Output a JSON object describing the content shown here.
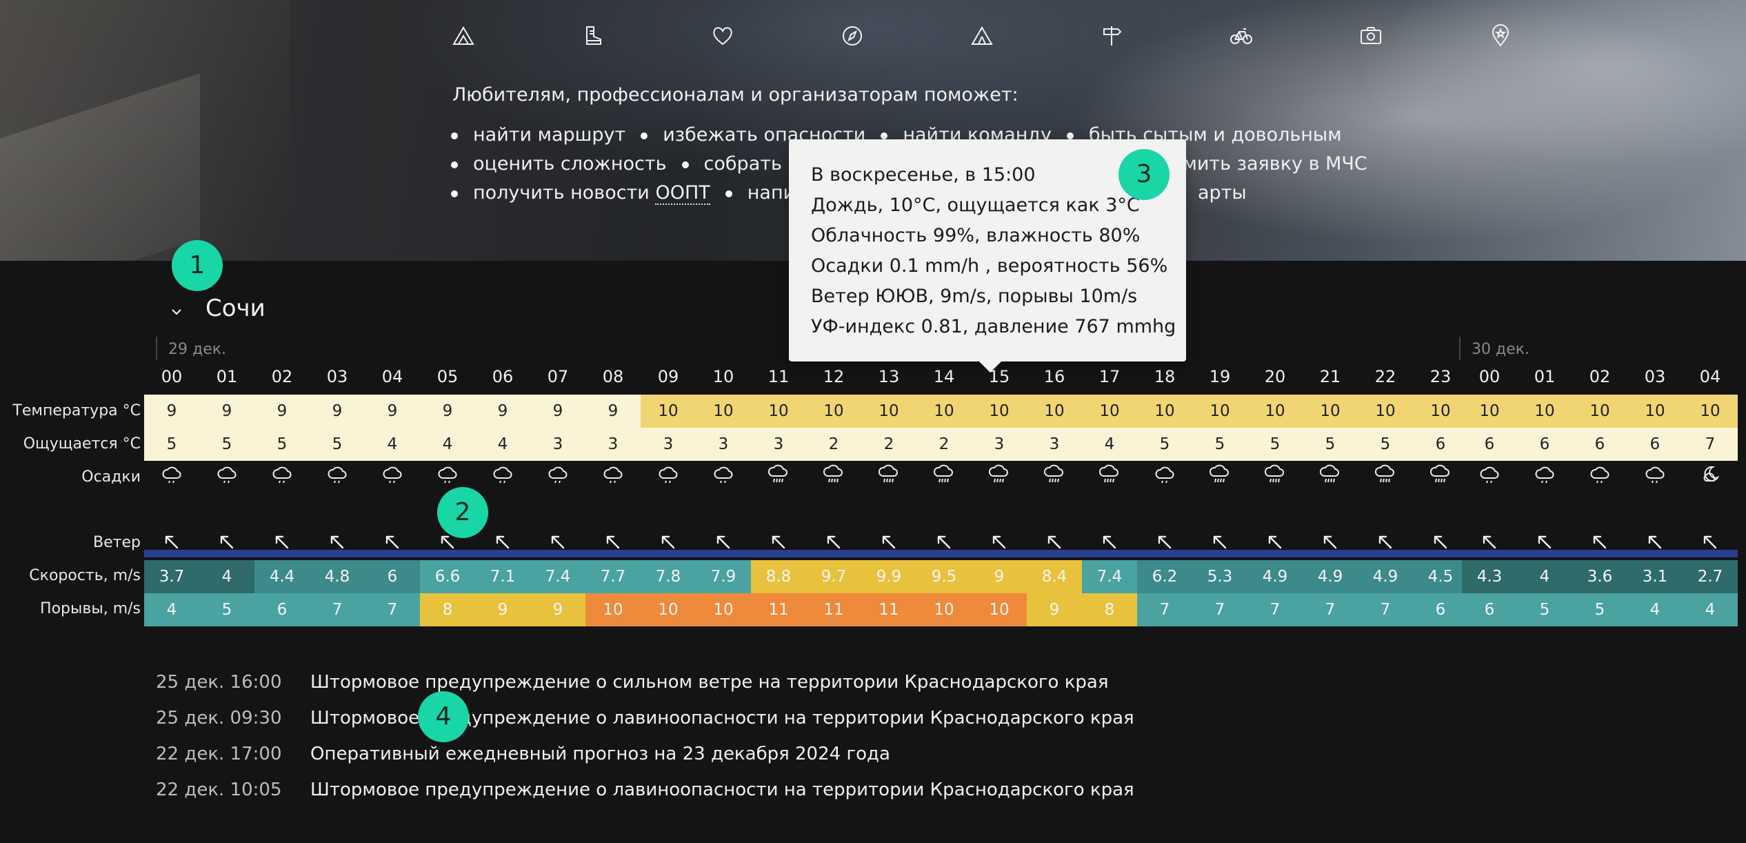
{
  "hero": {
    "icons": [
      "mountain-icon",
      "boot-icon",
      "heart-icon",
      "compass-icon",
      "tent-icon",
      "signpost-icon",
      "bicycle-icon",
      "camera-icon",
      "map-pin-icon"
    ],
    "intro": "Любителям, профессионалам и организаторам поможет:",
    "bullet_rows": [
      [
        "найти маршрут",
        "избежать опасности",
        "найти команду",
        "быть сытым и довольным"
      ],
      [
        "оценить сложность",
        "собрать и",
        "омить заявку в МЧС"
      ],
      [
        "получить новости",
        "ООПТ",
        "напи",
        "арты"
      ]
    ]
  },
  "forecast": {
    "city": "Сочи",
    "dates": [
      "29 дек.",
      "30 дек."
    ],
    "hours_day1": [
      "00",
      "01",
      "02",
      "03",
      "04",
      "05",
      "06",
      "07",
      "08",
      "09",
      "10",
      "11",
      "12",
      "13",
      "14",
      "15",
      "16",
      "17",
      "18",
      "19",
      "20",
      "21",
      "22",
      "23"
    ],
    "hours_day2": [
      "00",
      "01",
      "02",
      "03",
      "04"
    ],
    "labels": {
      "temperature": "Температура °C",
      "feels": "Ощущается °C",
      "precip": "Осадки",
      "wind": "Ветер",
      "speed": "Скорость, m/s",
      "gusts": "Порывы, m/s"
    },
    "temperature": [
      "9",
      "9",
      "9",
      "9",
      "9",
      "9",
      "9",
      "9",
      "9",
      "10",
      "10",
      "10",
      "10",
      "10",
      "10",
      "10",
      "10",
      "10",
      "10",
      "10",
      "10",
      "10",
      "10",
      "10",
      "10",
      "10",
      "10",
      "10",
      "10"
    ],
    "feels": [
      "5",
      "5",
      "5",
      "5",
      "4",
      "4",
      "4",
      "3",
      "3",
      "3",
      "3",
      "3",
      "2",
      "2",
      "2",
      "3",
      "3",
      "4",
      "5",
      "5",
      "5",
      "5",
      "5",
      "6",
      "6",
      "6",
      "6",
      "6",
      "7"
    ],
    "precip": [
      "cloud-rain-light-icon",
      "cloud-rain-light-icon",
      "cloud-rain-light-icon",
      "cloud-rain-light-icon",
      "cloud-rain-light-icon",
      "cloud-rain-light-icon",
      "cloud-rain-light-icon",
      "cloud-rain-light-icon",
      "cloud-rain-light-icon",
      "cloud-rain-light-icon",
      "cloud-rain-light-icon",
      "cloud-rain-icon",
      "cloud-rain-icon",
      "cloud-rain-icon",
      "cloud-rain-icon",
      "cloud-rain-icon",
      "cloud-rain-icon",
      "cloud-rain-icon",
      "cloud-rain-light-icon",
      "cloud-rain-icon",
      "cloud-rain-icon",
      "cloud-rain-icon",
      "cloud-rain-icon",
      "cloud-rain-icon",
      "cloud-rain-light-icon",
      "cloud-rain-light-icon",
      "cloud-rain-light-icon",
      "cloud-rain-light-icon",
      "moon-cloud-icon"
    ],
    "wind_direction": "ЮЮВ",
    "speed": [
      "3.7",
      "4",
      "4.4",
      "4.8",
      "6",
      "6.6",
      "7.1",
      "7.4",
      "7.7",
      "7.8",
      "7.9",
      "8.8",
      "9.7",
      "9.9",
      "9.5",
      "9",
      "8.4",
      "7.4",
      "6.2",
      "5.3",
      "4.9",
      "4.9",
      "4.9",
      "4.5",
      "4.3",
      "4",
      "3.6",
      "3.1",
      "2.7"
    ],
    "gusts": [
      "4",
      "5",
      "6",
      "7",
      "7",
      "8",
      "9",
      "9",
      "10",
      "10",
      "10",
      "11",
      "11",
      "11",
      "10",
      "10",
      "9",
      "8",
      "7",
      "7",
      "7",
      "7",
      "7",
      "6",
      "6",
      "5",
      "5",
      "4",
      "4"
    ],
    "colors": {
      "temp_low": "#fbf3d6",
      "temp_high": "#f2d573",
      "feels": "#fbf3d6",
      "wind_bar": "#2a3f8f",
      "teal_dark": "#2f6b6b",
      "teal_mid": "#3d8a8a",
      "teal_light": "#4aa3a0",
      "yellow": "#e8c23d",
      "orange": "#ee8a3a"
    }
  },
  "tooltip": {
    "lines": [
      "В воскресенье, в 15:00",
      "Дождь, 10°C, ощущается как 3°C",
      "Облачность 99%, влажность 80%",
      "Осадки 0.1 mm/h , вероятность 56%",
      "Ветер ЮЮВ, 9m/s, порывы 10m/s",
      "УФ-индекс 0.81, давление 767 mmhg"
    ]
  },
  "markers": [
    "1",
    "2",
    "3",
    "4"
  ],
  "warnings": [
    {
      "time": "25 дек. 16:00",
      "text": "Штормовое предупреждение о сильном ветре на территории Краснодарского края"
    },
    {
      "time": "25 дек. 09:30",
      "text": "Штормовое предупреждение о лавиноопасности на территории Краснодарского края"
    },
    {
      "time": "22 дек. 17:00",
      "text": "Оперативный ежедневный прогноз на 23 декабря 2024 года"
    },
    {
      "time": "22 дек. 10:05",
      "text": "Штормовое предупреждение о лавиноопасности на территории Краснодарского края"
    }
  ]
}
